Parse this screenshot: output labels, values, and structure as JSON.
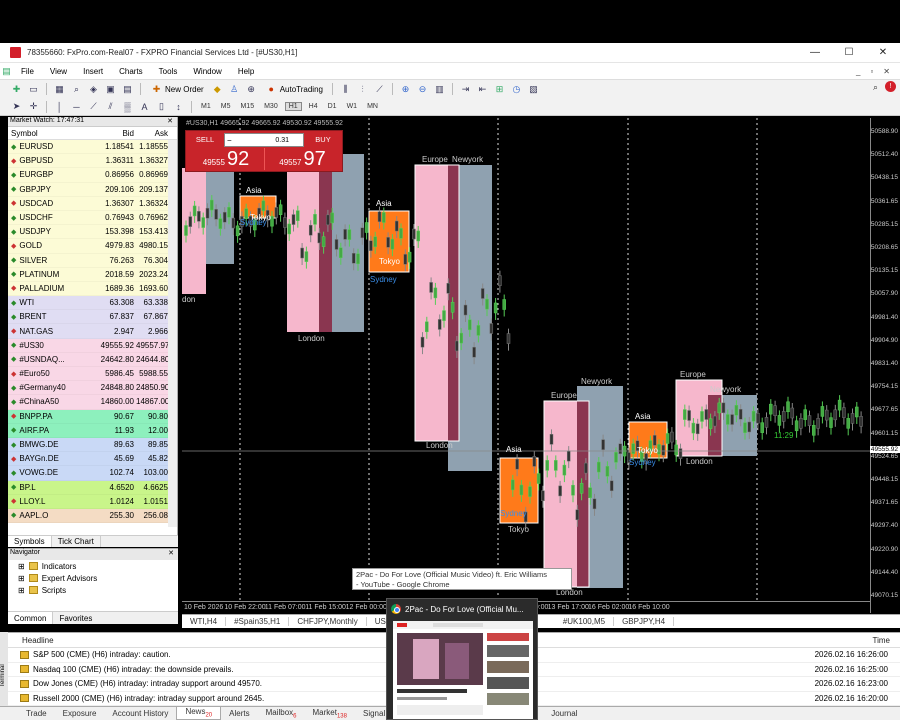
{
  "window": {
    "title": "78355660: FxPro.com-Real07 - FXPRO Financial Services Ltd - [#US30,H1]",
    "min": "—",
    "max": "☐",
    "close": "✕"
  },
  "menu": [
    "File",
    "View",
    "Insert",
    "Charts",
    "Tools",
    "Window",
    "Help"
  ],
  "mdi_controls": [
    "_",
    "▫",
    "✕"
  ],
  "toolbar": {
    "new_order": "New Order",
    "autotrading": "AutoTrading",
    "timeframes": [
      "M1",
      "M5",
      "M15",
      "M30",
      "H1",
      "H4",
      "D1",
      "W1",
      "MN"
    ]
  },
  "market_watch": {
    "title": "Market Watch: 17:47:31",
    "col_symbol": "Symbol",
    "col_bid": "Bid",
    "col_ask": "Ask",
    "rows": [
      {
        "s": "EURUSD",
        "b": "1.18541",
        "a": "1.18555",
        "bg": "#fcfbd6"
      },
      {
        "s": "GBPUSD",
        "b": "1.36311",
        "a": "1.36327",
        "bg": "#fcfbd6"
      },
      {
        "s": "EURGBP",
        "b": "0.86956",
        "a": "0.86969",
        "bg": "#fcfbd6"
      },
      {
        "s": "GBPJPY",
        "b": "209.106",
        "a": "209.137",
        "bg": "#fcfbd6"
      },
      {
        "s": "USDCAD",
        "b": "1.36307",
        "a": "1.36324",
        "bg": "#fcfbd6"
      },
      {
        "s": "USDCHF",
        "b": "0.76943",
        "a": "0.76962",
        "bg": "#fcfbd6"
      },
      {
        "s": "USDJPY",
        "b": "153.398",
        "a": "153.413",
        "bg": "#fcfbd6"
      },
      {
        "s": "GOLD",
        "b": "4979.83",
        "a": "4980.15",
        "bg": "#fcfbd6"
      },
      {
        "s": "SILVER",
        "b": "76.263",
        "a": "76.304",
        "bg": "#fcfbd6"
      },
      {
        "s": "PLATINUM",
        "b": "2018.59",
        "a": "2023.24",
        "bg": "#fcfbd6"
      },
      {
        "s": "PALLADIUM",
        "b": "1689.36",
        "a": "1693.60",
        "bg": "#fcfbd6"
      },
      {
        "s": "WTI",
        "b": "63.308",
        "a": "63.338",
        "bg": "#e0ddf3"
      },
      {
        "s": "BRENT",
        "b": "67.837",
        "a": "67.867",
        "bg": "#e0ddf3"
      },
      {
        "s": "NAT.GAS",
        "b": "2.947",
        "a": "2.966",
        "bg": "#e0ddf3"
      },
      {
        "s": "#US30",
        "b": "49555.92",
        "a": "49557.97",
        "bg": "#f9d7e6"
      },
      {
        "s": "#USNDAQ...",
        "b": "24642.80",
        "a": "24644.80",
        "bg": "#f9d7e6"
      },
      {
        "s": "#Euro50",
        "b": "5986.45",
        "a": "5988.55",
        "bg": "#f9d7e6"
      },
      {
        "s": "#Germany40",
        "b": "24848.80",
        "a": "24850.90",
        "bg": "#f9d7e6"
      },
      {
        "s": "#ChinaA50",
        "b": "14860.00",
        "a": "14867.00",
        "bg": "#f9d7e6"
      },
      {
        "s": "BNPP.PA",
        "b": "90.67",
        "a": "90.80",
        "bg": "#8df0bd"
      },
      {
        "s": "AIRF.PA",
        "b": "11.93",
        "a": "12.00",
        "bg": "#8df0bd"
      },
      {
        "s": "BMWG.DE",
        "b": "89.63",
        "a": "89.85",
        "bg": "#c9d9f6"
      },
      {
        "s": "BAYGn.DE",
        "b": "45.69",
        "a": "45.82",
        "bg": "#c9d9f6"
      },
      {
        "s": "VOWG.DE",
        "b": "102.74",
        "a": "103.00",
        "bg": "#c9d9f6"
      },
      {
        "s": "BP.L",
        "b": "4.6520",
        "a": "4.6625",
        "bg": "#c9f58a"
      },
      {
        "s": "LLOY.L",
        "b": "1.0124",
        "a": "1.0151",
        "bg": "#c9f58a"
      },
      {
        "s": "AAPL.O",
        "b": "255.30",
        "a": "256.08",
        "bg": "#f4dcc4"
      }
    ],
    "tab_symbols": "Symbols",
    "tab_tick": "Tick Chart"
  },
  "navigator": {
    "title": "Navigator",
    "items": [
      "Indicators",
      "Expert Advisors",
      "Scripts"
    ],
    "tab_common": "Common",
    "tab_favorites": "Favorites"
  },
  "chart": {
    "ohlc": "#US30,H1  49665.92 49665.92 49530.92 49555.92",
    "trade": {
      "sell": "SELL",
      "buy": "BUY",
      "volume": "0.31",
      "sell_small": "49555",
      "sell_big": "92",
      "buy_small": "49557",
      "buy_big": "97"
    },
    "price_labels": [
      "50588.90",
      "50512.40",
      "50438.15",
      "50361.65",
      "50285.15",
      "50208.65",
      "50135.15",
      "50057.90",
      "49981.40",
      "49904.90",
      "49831.40",
      "49754.15",
      "49677.65",
      "49601.15",
      "49524.65",
      "49448.15",
      "49371.65",
      "49297.40",
      "49220.90",
      "49144.40",
      "49070.15"
    ],
    "current_price": "49555.92",
    "time_labels": [
      "10 Feb 2026",
      "10 Feb 22:00",
      "11 Feb 07:00",
      "11 Feb 15:00",
      "12 Feb 00:00",
      "12 Feb 08:00",
      "12 Feb 16:00",
      "13 Feb 01:00",
      "13 Feb 09:00",
      "13 Feb 17:00",
      "16 Feb 02:00",
      "16 Feb 10:00"
    ],
    "countdown": "11:29",
    "sessions": {
      "asia": "Asia",
      "tokyo": "Tokyo",
      "sydney": "Sydney",
      "london": "London",
      "europe": "Europe",
      "newyork": "Newyork",
      "london_partial": "don"
    }
  },
  "sheet_tabs": [
    "WTI,H4",
    "#Spain35,H1",
    "CHFJPY,Monthly",
    "US",
    "#UK100,M5",
    "GBPJPY,H4"
  ],
  "news": {
    "col_headline": "Headline",
    "col_time": "Time",
    "rows": [
      {
        "h": "S&P 500 (CME) (H6) intraday: caution.",
        "t": "2026.02.16 16:26:00"
      },
      {
        "h": "Nasdaq 100 (CME) (H6) intraday: the downside prevails.",
        "t": "2026.02.16 16:25:00"
      },
      {
        "h": "Dow Jones (CME) (H6) intraday: intraday support around 49570.",
        "t": "2026.02.16 16:23:00"
      },
      {
        "h": "Russell 2000 (CME) (H6) intraday: intraday support around 2645.",
        "t": "2026.02.16 16:20:00"
      }
    ]
  },
  "terminal_tabs": [
    {
      "l": "Trade",
      "b": ""
    },
    {
      "l": "Exposure",
      "b": ""
    },
    {
      "l": "Account History",
      "b": ""
    },
    {
      "l": "News",
      "b": "20"
    },
    {
      "l": "Alerts",
      "b": ""
    },
    {
      "l": "Mailbox",
      "b": "6"
    },
    {
      "l": "Market",
      "b": "138"
    },
    {
      "l": "Signal",
      "b": ""
    }
  ],
  "terminal_tab_journal": "Journal",
  "terminal_side": "Terminal",
  "chrome_tooltip": {
    "line1": "2Pac - Do For Love (Official Music Video) ft. Eric Williams",
    "line2": "- YouTube - Google Chrome"
  },
  "chrome_popup": {
    "title": "2Pac - Do For Love (Official Mu..."
  }
}
